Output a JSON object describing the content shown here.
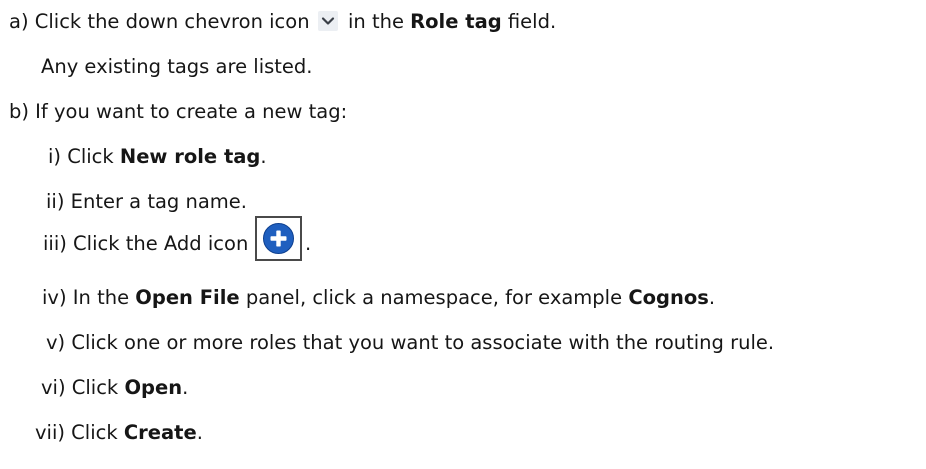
{
  "steps": {
    "a": {
      "prefix": "a) Click the down chevron icon",
      "middle": " in the ",
      "bold": "Role tag",
      "suffix": " field."
    },
    "a_note": "Any existing tags are listed.",
    "b": "b) If you want to create a new tag:",
    "i": {
      "prefix": "i) Click ",
      "bold": "New role tag",
      "suffix": "."
    },
    "ii": "ii) Enter a tag name.",
    "iii": {
      "text": "iii) Click the Add icon",
      "suffix": "."
    },
    "iv": {
      "prefix": "iv) In the ",
      "bold1": "Open File",
      "middle": " panel, click a namespace, for example ",
      "bold2": "Cognos",
      "suffix": "."
    },
    "v": "v) Click one or more roles that you want to associate with the routing rule.",
    "vi": {
      "prefix": "vi) Click ",
      "bold": "Open",
      "suffix": "."
    },
    "vii": {
      "prefix": "vii) Click ",
      "bold": "Create",
      "suffix": "."
    }
  },
  "icons": {
    "chevron": "chevron-down-icon",
    "add": "add-plus-icon"
  },
  "colors": {
    "text": "#161616",
    "add_icon_blue": "#1f5fbf",
    "chevron_bg": "#eceff3"
  }
}
